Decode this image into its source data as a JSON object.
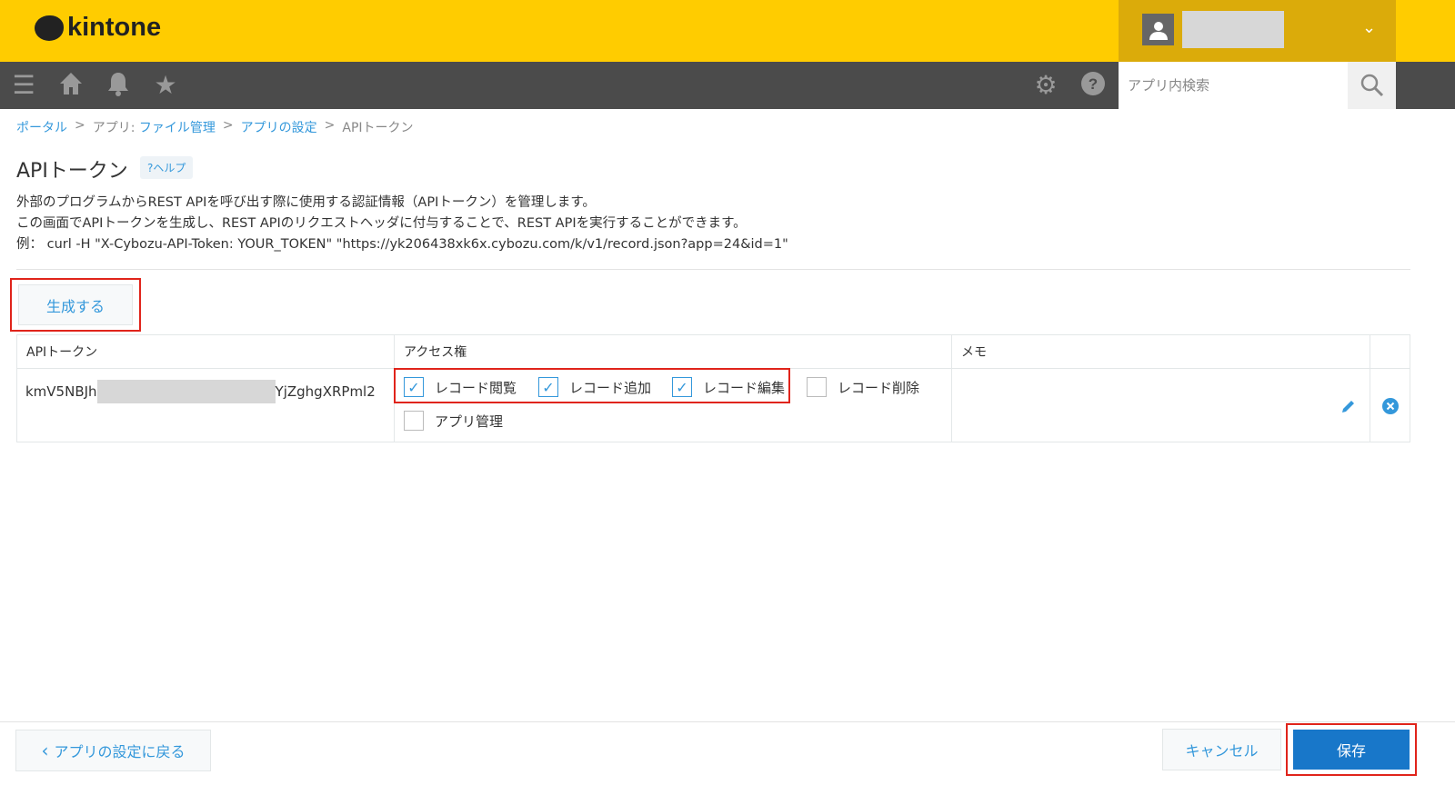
{
  "header": {
    "logo": "kintone",
    "search_placeholder": "アプリ内検索"
  },
  "breadcrumb": {
    "portal": "ポータル",
    "sep": ">",
    "app_prefix": "アプリ:",
    "app_name": "ファイル管理",
    "settings": "アプリの設定",
    "current": "APIトークン"
  },
  "page": {
    "title": "APIトークン",
    "help": "?ヘルプ",
    "desc": [
      "外部のプログラムからREST APIを呼び出す際に使用する認証情報（APIトークン）を管理します。",
      "この画面でAPIトークンを生成し、REST APIのリクエストヘッダに付与することで、REST APIを実行することができます。",
      "例：  curl -H \"X-Cybozu-API-Token: YOUR_TOKEN\" \"https://yk206438xk6x.cybozu.com/k/v1/record.json?app=24&id=1\""
    ],
    "generate": "生成する"
  },
  "table": {
    "headers": [
      "APIトークン",
      "アクセス権",
      "メモ"
    ],
    "row": {
      "token_start": "kmV5NBJh",
      "token_end": "YjZghgXRPml2",
      "perms": [
        {
          "label": "レコード閲覧",
          "checked": true
        },
        {
          "label": "レコード追加",
          "checked": true
        },
        {
          "label": "レコード編集",
          "checked": true
        },
        {
          "label": "レコード削除",
          "checked": false
        },
        {
          "label": "アプリ管理",
          "checked": false
        }
      ],
      "memo": ""
    }
  },
  "footer": {
    "back": "アプリの設定に戻る",
    "cancel": "キャンセル",
    "save": "保存"
  }
}
